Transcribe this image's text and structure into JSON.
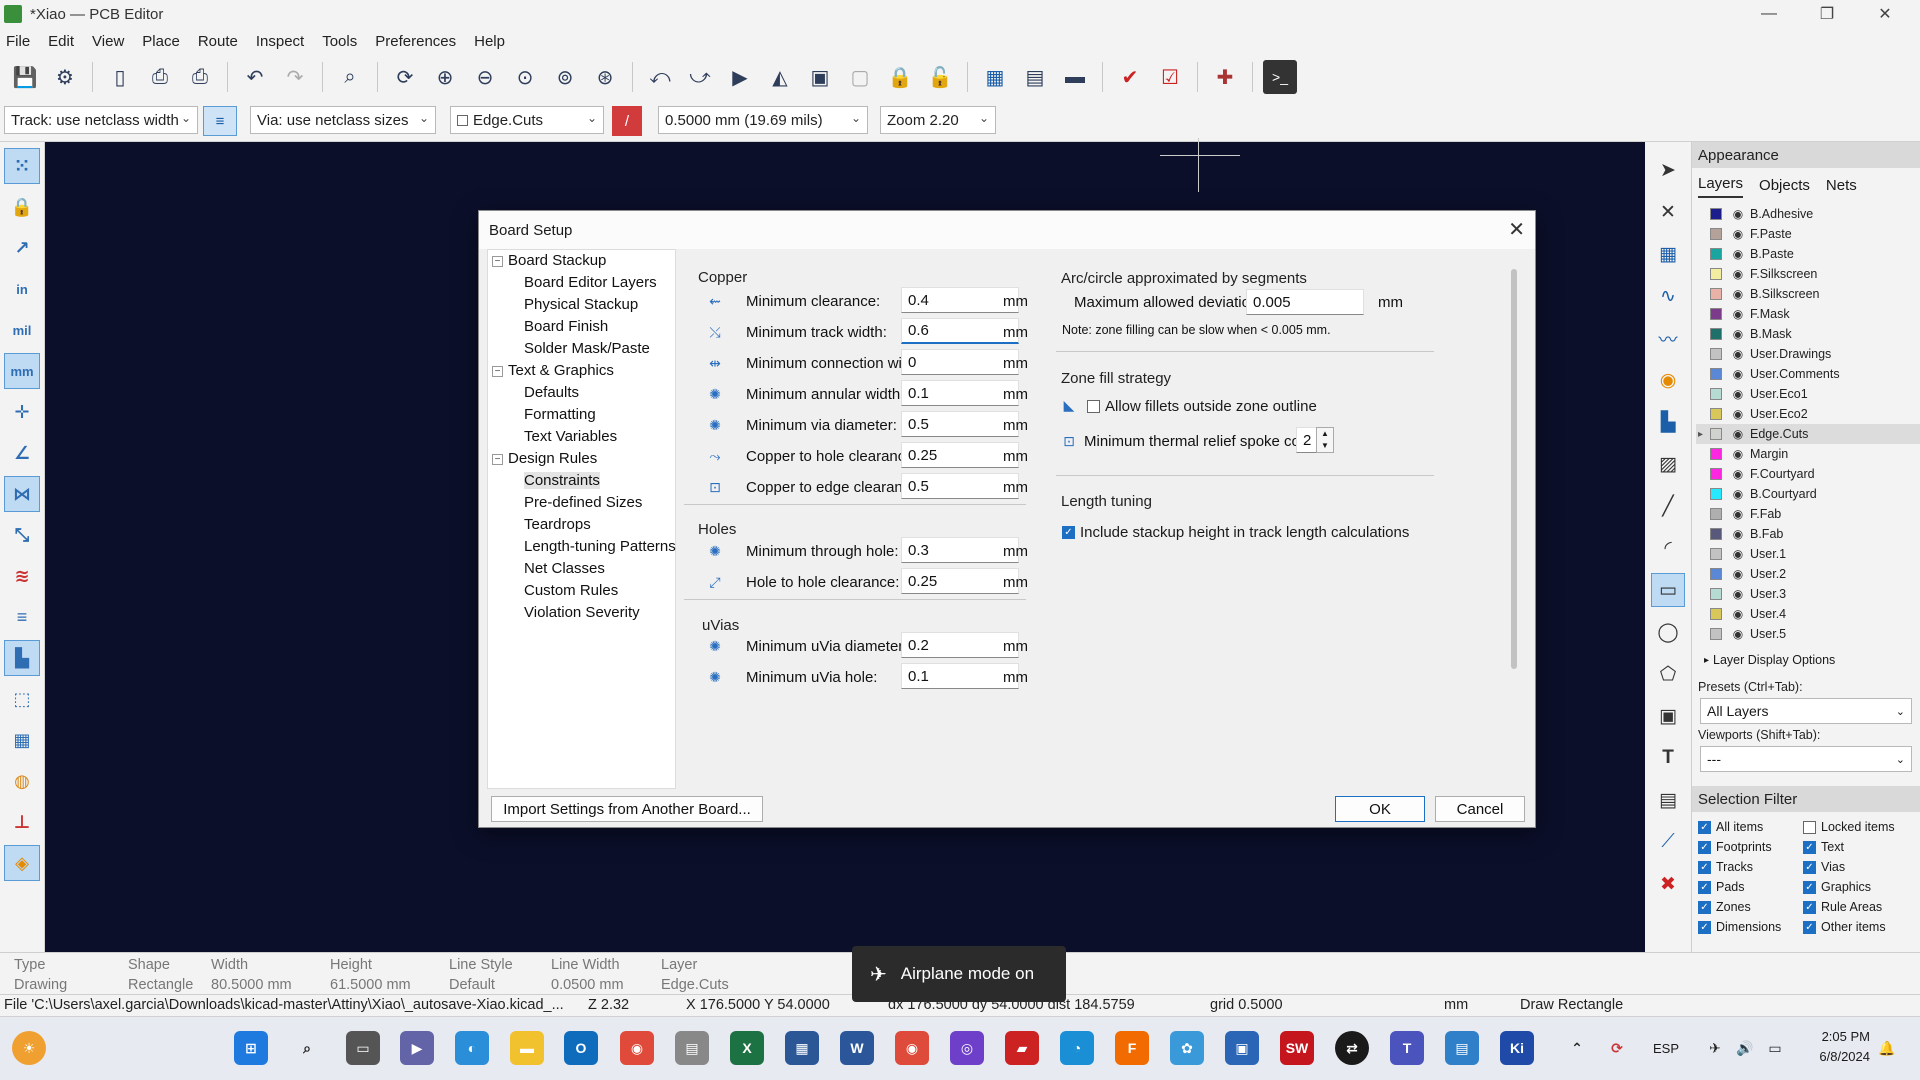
{
  "window": {
    "title": "*Xiao — PCB Editor"
  },
  "menu": [
    "File",
    "Edit",
    "View",
    "Place",
    "Route",
    "Inspect",
    "Tools",
    "Preferences",
    "Help"
  ],
  "aux": {
    "track": "Track: use netclass width",
    "via": "Via: use netclass sizes",
    "layer": "Edge.Cuts",
    "grid": "0.5000 mm (19.69 mils)",
    "zoom": "Zoom 2.20"
  },
  "dialog": {
    "title": "Board Setup",
    "tree": [
      {
        "label": "Board Stackup",
        "level": 0,
        "expander": "−"
      },
      {
        "label": "Board Editor Layers",
        "level": 1
      },
      {
        "label": "Physical Stackup",
        "level": 1
      },
      {
        "label": "Board Finish",
        "level": 1
      },
      {
        "label": "Solder Mask/Paste",
        "level": 1
      },
      {
        "label": "Text & Graphics",
        "level": 0,
        "expander": "−"
      },
      {
        "label": "Defaults",
        "level": 1
      },
      {
        "label": "Formatting",
        "level": 1
      },
      {
        "label": "Text Variables",
        "level": 1
      },
      {
        "label": "Design Rules",
        "level": 0,
        "expander": "−"
      },
      {
        "label": "Constraints",
        "level": 1,
        "selected": true
      },
      {
        "label": "Pre-defined Sizes",
        "level": 1
      },
      {
        "label": "Teardrops",
        "level": 1
      },
      {
        "label": "Length-tuning Patterns",
        "level": 1
      },
      {
        "label": "Net Classes",
        "level": 1
      },
      {
        "label": "Custom Rules",
        "level": 1
      },
      {
        "label": "Violation Severity",
        "level": 1
      }
    ],
    "copper": {
      "heading": "Copper",
      "rows": [
        {
          "label": "Minimum clearance:",
          "value": "0.4",
          "unit": "mm"
        },
        {
          "label": "Minimum track width:",
          "value": "0.6",
          "unit": "mm"
        },
        {
          "label": "Minimum connection width:",
          "value": "0",
          "unit": "mm"
        },
        {
          "label": "Minimum annular width:",
          "value": "0.1",
          "unit": "mm"
        },
        {
          "label": "Minimum via diameter:",
          "value": "0.5",
          "unit": "mm"
        },
        {
          "label": "Copper to hole clearance:",
          "value": "0.25",
          "unit": "mm"
        },
        {
          "label": "Copper to edge clearance:",
          "value": "0.5",
          "unit": "mm"
        }
      ]
    },
    "holes": {
      "heading": "Holes",
      "rows": [
        {
          "label": "Minimum through hole:",
          "value": "0.3",
          "unit": "mm"
        },
        {
          "label": "Hole to hole clearance:",
          "value": "0.25",
          "unit": "mm"
        }
      ]
    },
    "uvias": {
      "heading": "uVias",
      "rows": [
        {
          "label": "Minimum uVia diameter:",
          "value": "0.2",
          "unit": "mm"
        },
        {
          "label": "Minimum uVia hole:",
          "value": "0.1",
          "unit": "mm"
        }
      ]
    },
    "arc": {
      "heading": "Arc/circle approximated by segments",
      "label": "Maximum allowed deviation:",
      "value": "0.005",
      "unit": "mm",
      "note": "Note: zone filling can be slow when < 0.005 mm."
    },
    "zone": {
      "heading": "Zone fill strategy",
      "fillets_label": "Allow fillets outside zone outline",
      "fillets_checked": false,
      "spoke_label": "Minimum thermal relief spoke count:",
      "spoke_value": "2"
    },
    "length": {
      "heading": "Length tuning",
      "label": "Include stackup height in track length calculations",
      "checked": true
    },
    "import_button": "Import Settings from Another Board...",
    "ok": "OK",
    "cancel": "Cancel"
  },
  "appearance": {
    "title": "Appearance",
    "tabs": [
      "Layers",
      "Objects",
      "Nets"
    ],
    "layers": [
      {
        "name": "B.Adhesive",
        "color": "#1b1d8c"
      },
      {
        "name": "F.Paste",
        "color": "#b4a19a"
      },
      {
        "name": "B.Paste",
        "color": "#1aa6a0"
      },
      {
        "name": "F.Silkscreen",
        "color": "#f2eda1"
      },
      {
        "name": "B.Silkscreen",
        "color": "#e8b2a7"
      },
      {
        "name": "F.Mask",
        "color": "#7d3c8a"
      },
      {
        "name": "B.Mask",
        "color": "#1f6f6a"
      },
      {
        "name": "User.Drawings",
        "color": "#c2c2c2"
      },
      {
        "name": "User.Comments",
        "color": "#5a88d6"
      },
      {
        "name": "User.Eco1",
        "color": "#b5dbd2"
      },
      {
        "name": "User.Eco2",
        "color": "#d8c85a"
      },
      {
        "name": "Edge.Cuts",
        "color": "#d0d2cd",
        "selected": true
      },
      {
        "name": "Margin",
        "color": "#ff26e2"
      },
      {
        "name": "F.Courtyard",
        "color": "#ff26e2"
      },
      {
        "name": "B.Courtyard",
        "color": "#26e9ff"
      },
      {
        "name": "F.Fab",
        "color": "#afafaf"
      },
      {
        "name": "B.Fab",
        "color": "#58587a"
      },
      {
        "name": "User.1",
        "color": "#c2c2c2"
      },
      {
        "name": "User.2",
        "color": "#5a88d6"
      },
      {
        "name": "User.3",
        "color": "#b5dbd2"
      },
      {
        "name": "User.4",
        "color": "#d8c85a"
      },
      {
        "name": "User.5",
        "color": "#c2c2c2"
      }
    ],
    "layer_display_options": "Layer Display Options",
    "presets_label": "Presets (Ctrl+Tab):",
    "presets_value": "All Layers",
    "viewports_label": "Viewports (Shift+Tab):",
    "viewports_value": "---",
    "selection_filter": "Selection Filter",
    "filters": [
      {
        "label": "All items",
        "checked": true
      },
      {
        "label": "Locked items",
        "checked": false
      },
      {
        "label": "Footprints",
        "checked": true
      },
      {
        "label": "Text",
        "checked": true
      },
      {
        "label": "Tracks",
        "checked": true
      },
      {
        "label": "Vias",
        "checked": true
      },
      {
        "label": "Pads",
        "checked": true
      },
      {
        "label": "Graphics",
        "checked": true
      },
      {
        "label": "Zones",
        "checked": true
      },
      {
        "label": "Rule Areas",
        "checked": true
      },
      {
        "label": "Dimensions",
        "checked": true
      },
      {
        "label": "Other items",
        "checked": true
      }
    ]
  },
  "message_panel": [
    {
      "title": "Type",
      "value": "Drawing"
    },
    {
      "title": "Shape",
      "value": "Rectangle"
    },
    {
      "title": "Width",
      "value": "80.5000 mm"
    },
    {
      "title": "Height",
      "value": "61.5000 mm"
    },
    {
      "title": "Line Style",
      "value": "Default"
    },
    {
      "title": "Line Width",
      "value": "0.0500 mm"
    },
    {
      "title": "Layer",
      "value": "Edge.Cuts"
    }
  ],
  "status": {
    "file": "File 'C:\\Users\\axel.garcia\\Downloads\\kicad-master\\Attiny\\Xiao\\_autosave-Xiao.kicad_...",
    "z": "Z 2.32",
    "xy": "X 176.5000  Y 54.0000",
    "dxdy": "dx 176.5000  dy 54.0000  dist 184.5759",
    "grid": "grid 0.5000",
    "units": "mm",
    "tool": "Draw Rectangle"
  },
  "toast": "Airplane mode on",
  "taskbar": {
    "lang": "ESP",
    "time": "2:05 PM",
    "date": "6/8/2024"
  }
}
